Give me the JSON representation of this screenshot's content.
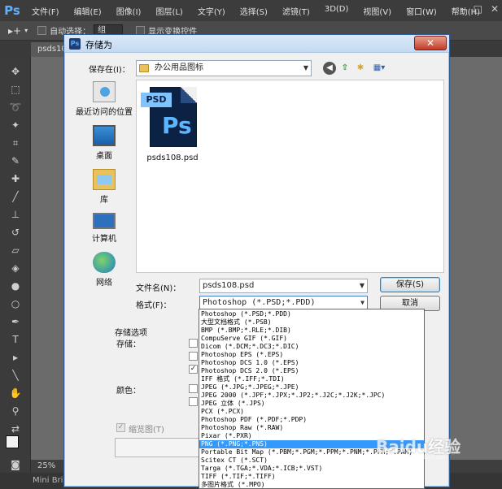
{
  "app": {
    "logo": "Ps"
  },
  "menubar": {
    "items": [
      "文件(F)",
      "编辑(E)",
      "图像(I)",
      "图层(L)",
      "文字(Y)",
      "选择(S)",
      "滤镜(T)",
      "3D(D)",
      "视图(V)",
      "窗口(W)",
      "帮助(H)"
    ]
  },
  "optionsbar": {
    "auto_select_label": "自动选择：",
    "auto_select_value": "组",
    "show_transform_label": "显示变换控件"
  },
  "document_tab": {
    "label": "psds10"
  },
  "statusbar": {
    "zoom": "25%"
  },
  "bottombar": {
    "label": "Mini Bridge"
  },
  "dialog": {
    "title": "存储为",
    "save_in_label": "保存在(I)：",
    "save_in_value": "办公用品图标",
    "places": [
      {
        "label": "最近访问的位置",
        "icon": "recent-places-icon"
      },
      {
        "label": "桌面",
        "icon": "desktop-icon"
      },
      {
        "label": "库",
        "icon": "library-icon"
      },
      {
        "label": "计算机",
        "icon": "computer-icon"
      },
      {
        "label": "网络",
        "icon": "network-icon"
      }
    ],
    "file": {
      "tag": "PSD",
      "mark": "Ps",
      "name": "psds108.psd"
    },
    "filename_label": "文件名(N)：",
    "filename_value": "psds108.psd",
    "format_label": "格式(F)：",
    "format_value": "Photoshop (*.PSD;*.PDD)",
    "save_button": "保存(S)",
    "cancel_button": "取消",
    "save_options_label": "存储选项",
    "save_label": "存储：",
    "color_label": "颜色：",
    "thumbnail_label": "缩览图(T)"
  },
  "format_options": [
    "Photoshop (*.PSD;*.PDD)",
    "大型文档格式 (*.PSB)",
    "BMP (*.BMP;*.RLE;*.DIB)",
    "CompuServe GIF (*.GIF)",
    "Dicom (*.DCM;*.DC3;*.DIC)",
    "Photoshop EPS (*.EPS)",
    "Photoshop DCS 1.0 (*.EPS)",
    "Photoshop DCS 2.0 (*.EPS)",
    "IFF 格式 (*.IFF;*.TDI)",
    "JPEG (*.JPG;*.JPEG;*.JPE)",
    "JPEG 2000 (*.JPF;*.JPX;*.JP2;*.J2C;*.J2K;*.JPC)",
    "JPEG 立体 (*.JPS)",
    "PCX (*.PCX)",
    "Photoshop PDF (*.PDF;*.PDP)",
    "Photoshop Raw (*.RAW)",
    "Pixar (*.PXR)",
    "PNG (*.PNG;*.PNS)",
    "Portable Bit Map (*.PBM;*.PGM;*.PPM;*.PNM;*.PFM;*.PAM)",
    "Scitex CT (*.SCT)",
    "Targa (*.TGA;*.VDA;*.ICB;*.VST)",
    "TIFF (*.TIF;*.TIFF)",
    "多图片格式 (*.MPO)"
  ],
  "selected_format_index": 16,
  "watermark": {
    "main": "Baidu经验",
    "sub": "jingyan.baidu.com"
  }
}
